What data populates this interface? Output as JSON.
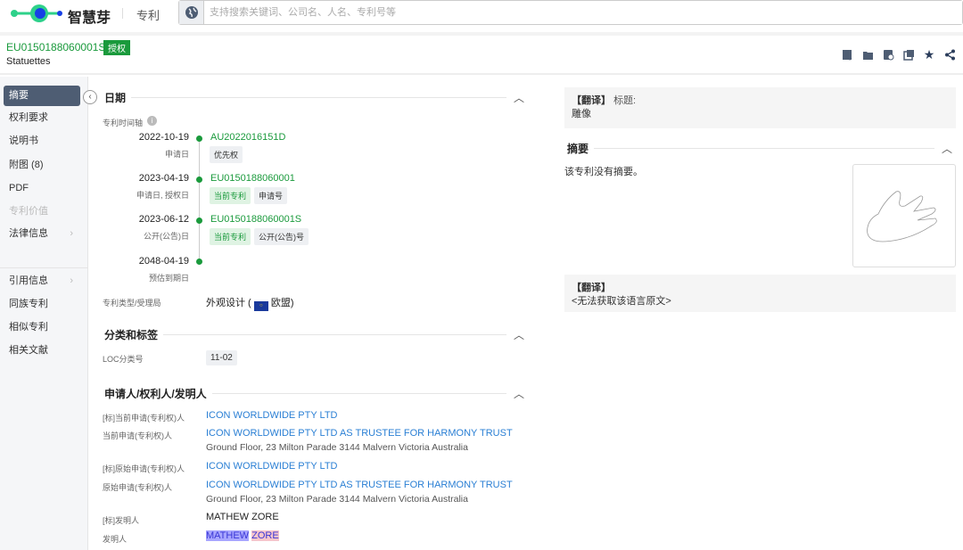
{
  "topbar": {
    "brand": "智慧芽",
    "module": "专利",
    "search_placeholder": "支持搜索关键词、公司名、人名、专利号等"
  },
  "header": {
    "patent_no": "EU0150188060001S",
    "status": "授权",
    "title": "Statuettes"
  },
  "sidebar": {
    "items": [
      {
        "label": "摘要"
      },
      {
        "label": "权利要求"
      },
      {
        "label": "说明书"
      },
      {
        "label": "附图 (8)"
      },
      {
        "label": "PDF"
      },
      {
        "label": "专利价值"
      },
      {
        "label": "法律信息"
      },
      {
        "label": "引用信息"
      },
      {
        "label": "同族专利"
      },
      {
        "label": "相似专利"
      },
      {
        "label": "相关文献"
      }
    ]
  },
  "dates": {
    "title": "日期",
    "timeline_label": "专利时间轴",
    "events": [
      {
        "date": "2022-10-19",
        "desc": "申请日",
        "number": "AU2022016151D",
        "tags": [
          "优先权"
        ]
      },
      {
        "date": "2023-04-19",
        "desc": "申请日, 授权日",
        "number": "EU0150188060001",
        "tags": [
          "当前专利",
          "申请号"
        ]
      },
      {
        "date": "2023-06-12",
        "desc": "公开(公告)日",
        "number": "EU0150188060001S",
        "tags": [
          "当前专利",
          "公开(公告)号"
        ]
      },
      {
        "date": "2048-04-19",
        "desc": "预估到期日"
      }
    ],
    "type_label": "专利类型/受理局",
    "type_value": "外观设计 (",
    "office": "欧盟)"
  },
  "classification": {
    "title": "分类和标签",
    "loc_label": "LOC分类号",
    "loc_value": "11-02"
  },
  "parties": {
    "title": "申请人/权利人/发明人",
    "rows": [
      {
        "label": "[标]当前申请(专利权)人",
        "value": "ICON WORLDWIDE PTY LTD"
      },
      {
        "label": "当前申请(专利权)人",
        "value": "ICON WORLDWIDE PTY LTD AS TRUSTEE FOR HARMONY TRUST",
        "address": "Ground Floor, 23 Milton Parade 3144 Malvern Victoria Australia"
      },
      {
        "label": "[标]原始申请(专利权)人",
        "value": "ICON WORLDWIDE PTY LTD"
      },
      {
        "label": "原始申请(专利权)人",
        "value": "ICON WORLDWIDE PTY LTD AS TRUSTEE FOR HARMONY TRUST",
        "address": "Ground Floor, 23 Milton Parade 3144 Malvern Victoria Australia"
      },
      {
        "label": "[标]发明人",
        "value": "MATHEW ZORE"
      },
      {
        "label": "发明人",
        "first": "MATHEW",
        "last": "ZORE"
      }
    ]
  },
  "right": {
    "translate_tag": "【翻译】",
    "title_label": "标题:",
    "title_value": "雕像",
    "abstract_title": "摘要",
    "abstract_text": "该专利没有摘要。",
    "original_text": "<无法获取该语言原文>"
  }
}
